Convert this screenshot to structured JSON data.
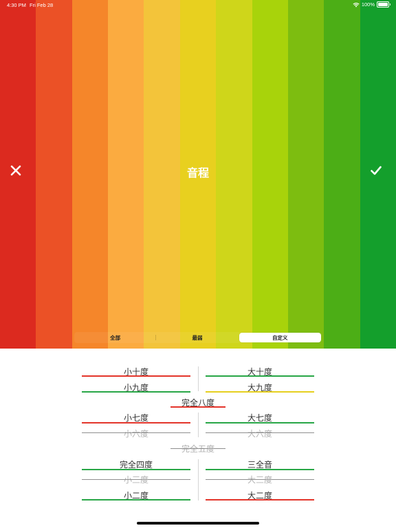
{
  "status_bar": {
    "time": "4:30 PM",
    "date": "Fri Feb 28",
    "battery": "100%",
    "battery_level": 1.0
  },
  "colors": {
    "stripes": [
      "#dc2a1f",
      "#eb5126",
      "#f5862a",
      "#fbab40",
      "#f3c43a",
      "#e8d01f",
      "#cfd61a",
      "#a8d30b",
      "#7dbd10",
      "#4cae16",
      "#149f2c"
    ],
    "red": "#e3342a",
    "green": "#27a646",
    "yellow": "#e6cf1e",
    "gray": "#8e8e8e"
  },
  "header": {
    "title": "音程",
    "close_icon": "close-x-icon",
    "confirm_icon": "checkmark-icon"
  },
  "segmented_control": {
    "options": [
      "全部",
      "最弱",
      "自定义"
    ],
    "selected": "自定义"
  },
  "intervals": {
    "minor_tenth": {
      "label": "小十度",
      "state": "red"
    },
    "major_tenth": {
      "label": "大十度",
      "state": "green"
    },
    "minor_ninth": {
      "label": "小九度",
      "state": "green"
    },
    "major_ninth": {
      "label": "大九度",
      "state": "yellow"
    },
    "perfect_octave": {
      "label": "完全八度",
      "state": "red"
    },
    "minor_seventh": {
      "label": "小七度",
      "state": "red"
    },
    "major_seventh": {
      "label": "大七度",
      "state": "green"
    },
    "minor_sixth": {
      "label": "小六度",
      "state": "disabled"
    },
    "major_sixth": {
      "label": "大六度",
      "state": "disabled"
    },
    "perfect_fifth": {
      "label": "完全五度",
      "state": "disabled"
    },
    "perfect_fourth": {
      "label": "完全四度",
      "state": "green"
    },
    "tritone": {
      "label": "三全音",
      "state": "green"
    },
    "minor_third": {
      "label": "小三度",
      "state": "disabled"
    },
    "major_third": {
      "label": "大三度",
      "state": "disabled"
    },
    "minor_second": {
      "label": "小二度",
      "state": "green"
    },
    "major_second": {
      "label": "大二度",
      "state": "red"
    }
  }
}
